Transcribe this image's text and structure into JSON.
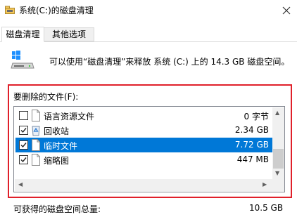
{
  "window": {
    "title": "系统(C:)的磁盘清理",
    "close_glyph": "✕"
  },
  "tabs": [
    {
      "label": "磁盘清理",
      "active": true
    },
    {
      "label": "其他选项",
      "active": false
    }
  ],
  "info": {
    "text": "可以使用“磁盘清理”来释放 系统 (C:) 上的 14.3 GB 磁盘空间。"
  },
  "files_group": {
    "label": "要删除的文件(F):",
    "items": [
      {
        "name": "语言资源文件",
        "size": "0 字节",
        "checked": false,
        "selected": false,
        "icon": "file-icon"
      },
      {
        "name": "回收站",
        "size": "2.34 GB",
        "checked": true,
        "selected": false,
        "icon": "recycle-bin-icon"
      },
      {
        "name": "临时文件",
        "size": "7.72 GB",
        "checked": true,
        "selected": true,
        "icon": "file-icon"
      },
      {
        "name": "缩略图",
        "size": "447 MB",
        "checked": true,
        "selected": false,
        "icon": "file-icon"
      }
    ]
  },
  "scrollbars": {
    "up": "▲",
    "down": "▼",
    "left": "◀",
    "right": "▶"
  },
  "total": {
    "label": "可获得的磁盘空间总量:",
    "value": "10.5 GB"
  },
  "colors": {
    "selection": "#0078d7",
    "highlight_frame": "#e0202a"
  }
}
